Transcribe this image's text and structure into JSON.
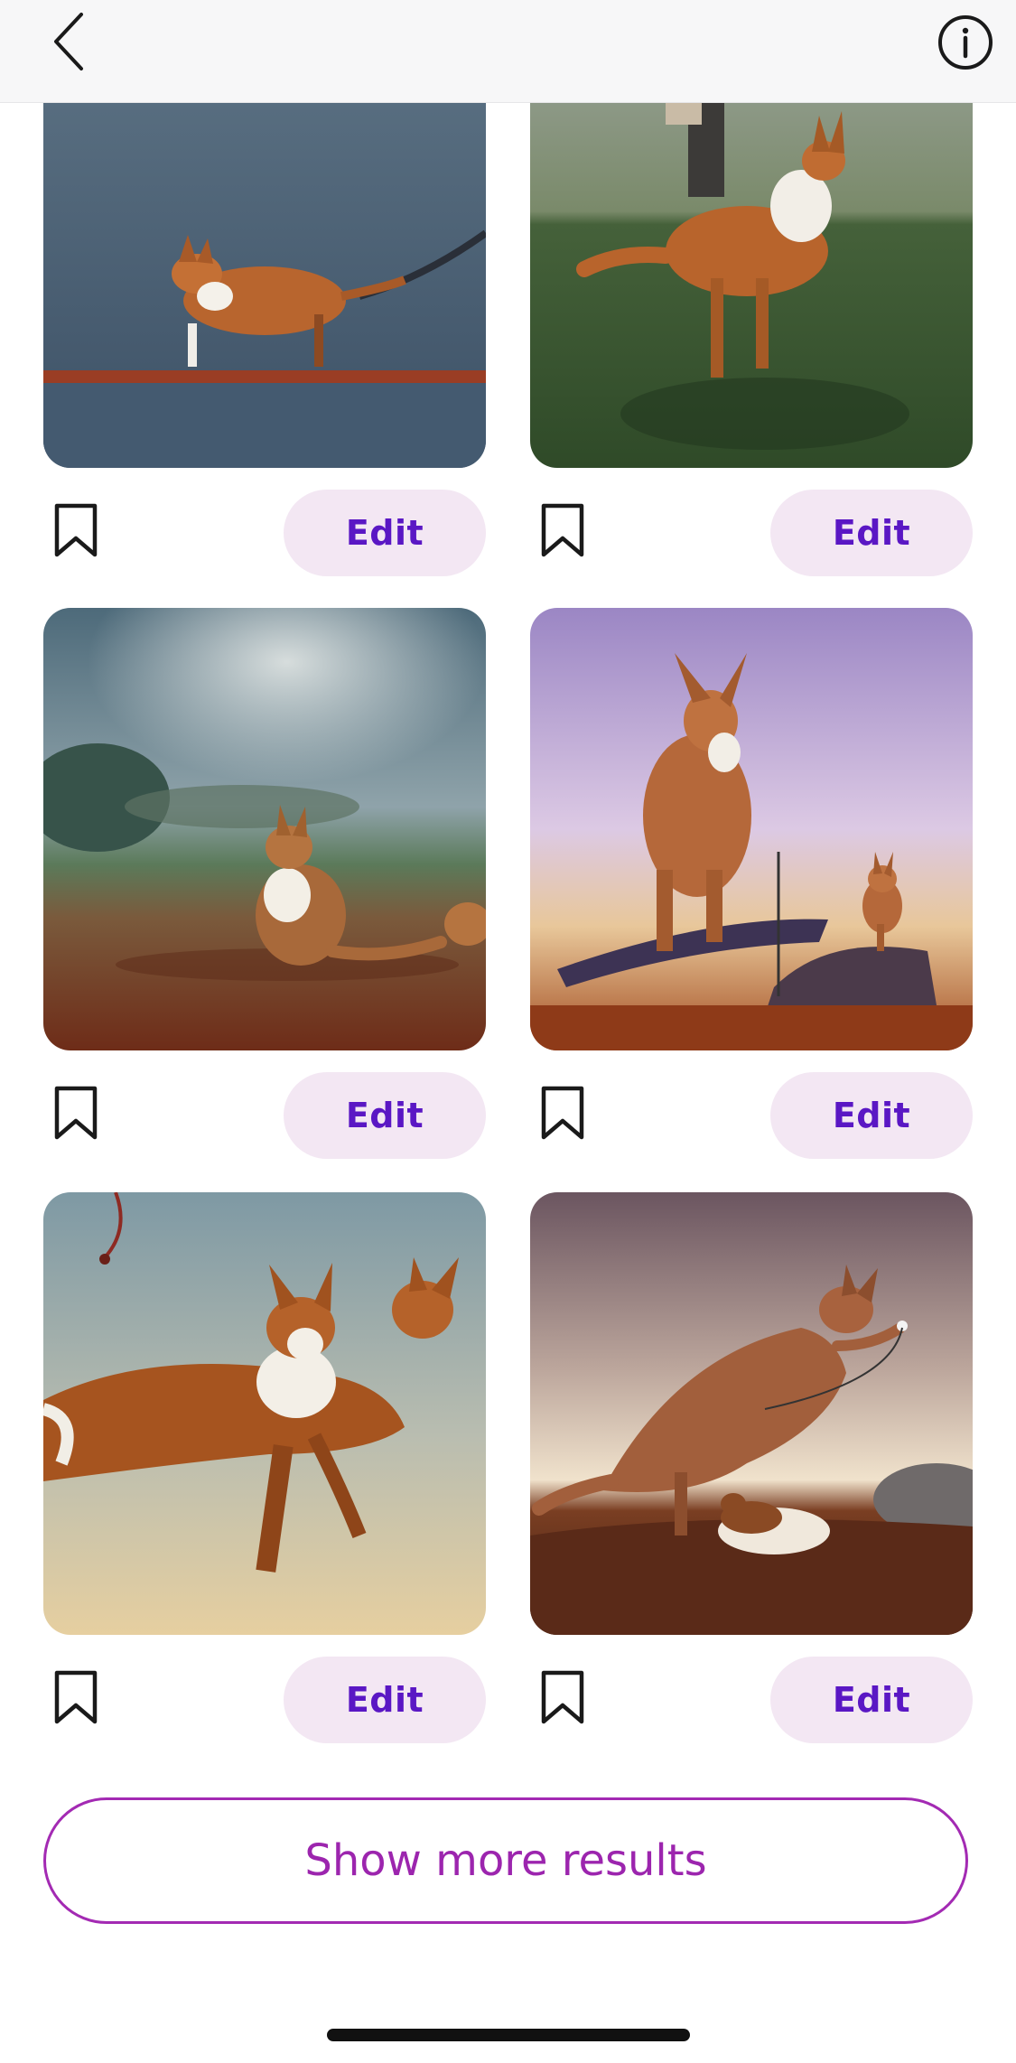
{
  "header": {
    "back_icon": "chevron-left-icon",
    "info_icon": "info-circle-icon"
  },
  "results": [
    {
      "image": "corgi-kangaroo-on-ledge-blue-backdrop",
      "edit_label": "Edit",
      "bookmark_icon": "bookmark-icon"
    },
    {
      "image": "corgi-kangaroo-leaping-on-grass",
      "edit_label": "Edit",
      "bookmark_icon": "bookmark-icon"
    },
    {
      "image": "corgi-kangaroo-sitting-cloudy-field",
      "edit_label": "Edit",
      "bookmark_icon": "bookmark-icon"
    },
    {
      "image": "kangaroo-on-rock-purple-sky",
      "edit_label": "Edit",
      "bookmark_icon": "bookmark-icon"
    },
    {
      "image": "corgis-riding-kangaroo",
      "edit_label": "Edit",
      "bookmark_icon": "bookmark-icon"
    },
    {
      "image": "kangaroo-walking-small-dog-on-leash",
      "edit_label": "Edit",
      "bookmark_icon": "bookmark-icon"
    }
  ],
  "show_more_label": "Show more results",
  "colors": {
    "accent": "#5a17c4",
    "edit_bg": "#f3e7f3",
    "outline": "#a32ab3"
  }
}
